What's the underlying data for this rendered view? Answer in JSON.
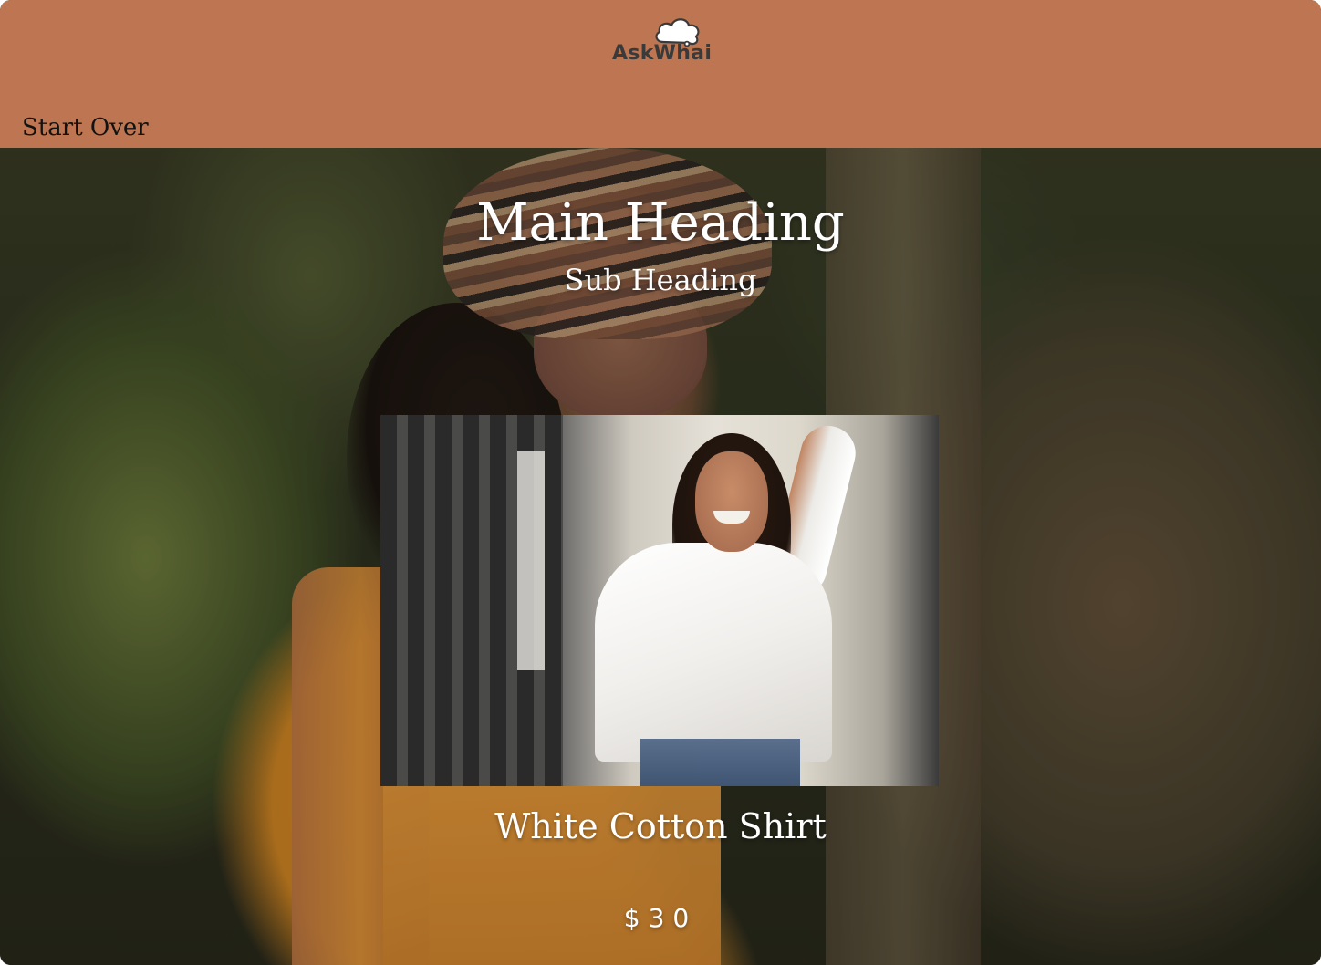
{
  "app": {
    "logo_text": "AskWhai",
    "logo_icon": "cloud-icon",
    "brand_color": "#bd7651"
  },
  "header": {
    "start_over_label": "Start Over"
  },
  "hero": {
    "main_heading": "Main Heading",
    "sub_heading": "Sub Heading"
  },
  "product": {
    "name": "White Cotton Shirt",
    "price": "$30"
  }
}
